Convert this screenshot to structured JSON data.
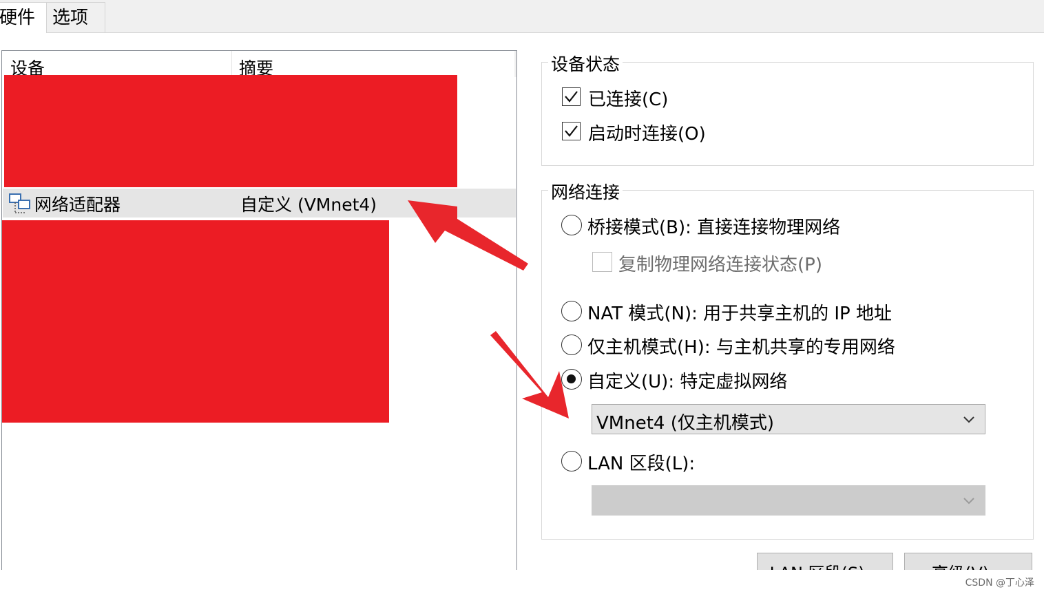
{
  "tabs": [
    {
      "label": "硬件"
    },
    {
      "label": "选项"
    }
  ],
  "device_list": {
    "headers": [
      "设备",
      "摘要"
    ],
    "selected_row": {
      "device": "网络适配器",
      "summary": "自定义 (VMnet4)",
      "icon": "network-adapter-icon"
    }
  },
  "device_status": {
    "title": "设备状态",
    "connected": {
      "label": "已连接(C)",
      "checked": true
    },
    "connect_at_power_on": {
      "label": "启动时连接(O)",
      "checked": true
    }
  },
  "network_connection": {
    "title": "网络连接",
    "options": [
      {
        "label": "桥接模式(B): 直接连接物理网络",
        "selected": false
      },
      {
        "label": "NAT 模式(N): 用于共享主机的 IP 地址",
        "selected": false
      },
      {
        "label": "仅主机模式(H): 与主机共享的专用网络",
        "selected": false
      },
      {
        "label": "自定义(U): 特定虚拟网络",
        "selected": true
      },
      {
        "label": "LAN 区段(L):",
        "selected": false
      }
    ],
    "replicate_state": {
      "label": "复制物理网络连接状态(P)",
      "checked": false,
      "disabled": true
    },
    "custom_network_value": "VMnet4 (仅主机模式)",
    "lan_segment_value": ""
  },
  "buttons": {
    "lan_segments": "LAN 区段(S)...",
    "advanced": "高级(V)..."
  },
  "credit": "CSDN @丁心泽",
  "colors": {
    "redaction": "#ec1c24",
    "annotation_arrow": "#e8262c",
    "selected_row": "#e5e5e5"
  }
}
